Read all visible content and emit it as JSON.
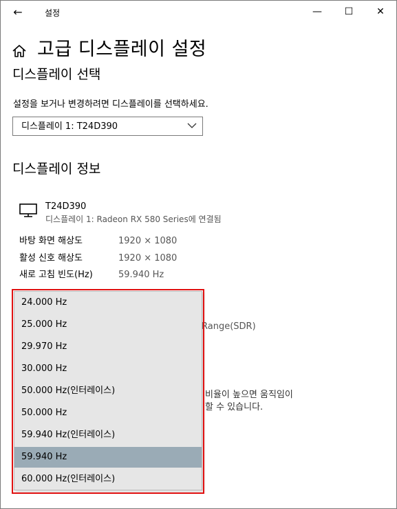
{
  "window": {
    "title": "설정",
    "back_glyph": "←",
    "minimize_glyph": "—",
    "maximize_glyph": "☐",
    "close_glyph": "✕"
  },
  "page": {
    "title": "고급 디스플레이 설정"
  },
  "display_select": {
    "heading": "디스플레이 선택",
    "instruction": "설정을 보거나 변경하려면 디스플레이를 선택하세요.",
    "selected_value": "디스플레이 1: T24D390"
  },
  "display_info": {
    "heading": "디스플레이 정보",
    "monitor_name": "T24D390",
    "connection": "디스플레이 1: Radeon RX 580 Series에 연결됨",
    "rows": [
      {
        "label": "바탕 화면 해상도",
        "value": "1920 × 1080"
      },
      {
        "label": "활성 신호 해상도",
        "value": "1920 × 1080"
      },
      {
        "label": "새로 고침 빈도(Hz)",
        "value": "59.940 Hz"
      }
    ],
    "partial_text": [
      "Range(SDR)",
      "비율이 높으면 움직임이",
      "할 수 있습니다."
    ]
  },
  "refresh_rate_dropdown": {
    "selected_index": 7,
    "options": [
      "24.000 Hz",
      "25.000 Hz",
      "29.970 Hz",
      "30.000 Hz",
      "50.000 Hz(인터레이스)",
      "50.000 Hz",
      "59.940 Hz(인터레이스)",
      "59.940 Hz",
      "60.000 Hz(인터레이스)"
    ]
  },
  "colors": {
    "highlight_border": "#e01010",
    "selected_option_bg": "#9aabb6",
    "dropdown_bg": "#e6e6e6"
  }
}
